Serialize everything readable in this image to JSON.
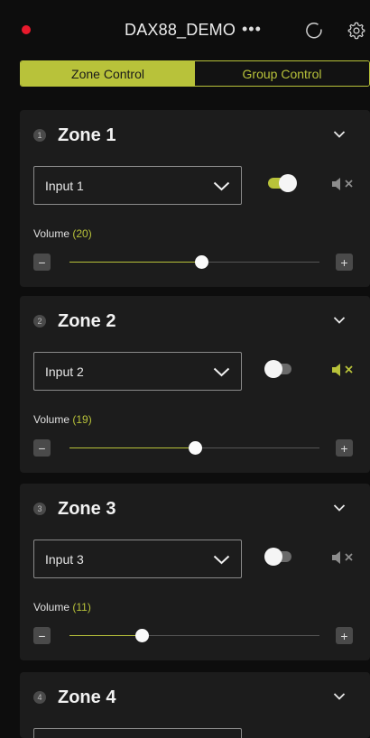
{
  "header": {
    "title": "DAX88_DEMO",
    "more_label": "•••",
    "status_color": "#e8192c",
    "accent_color": "#b8c23a",
    "icons": [
      "more-icon",
      "refresh-icon",
      "settings-gear-icon"
    ]
  },
  "tabs": [
    {
      "label": "Zone Control",
      "active": true
    },
    {
      "label": "Group Control",
      "active": false
    }
  ],
  "zones": [
    {
      "number": "1",
      "name": "Zone 1",
      "input": "Input 1",
      "enabled": true,
      "muted": false,
      "volume_label": "Volume",
      "volume_text": "(20)",
      "volume": 20,
      "volume_max": 38
    },
    {
      "number": "2",
      "name": "Zone 2",
      "input": "Input 2",
      "enabled": false,
      "muted": true,
      "volume_label": "Volume",
      "volume_text": "(19)",
      "volume": 19,
      "volume_max": 38
    },
    {
      "number": "3",
      "name": "Zone 3",
      "input": "Input 3",
      "enabled": false,
      "muted": false,
      "volume_label": "Volume",
      "volume_text": "(11)",
      "volume": 11,
      "volume_max": 38
    },
    {
      "number": "4",
      "name": "Zone 4"
    }
  ],
  "stepper": {
    "minus": "−",
    "plus": "+"
  }
}
